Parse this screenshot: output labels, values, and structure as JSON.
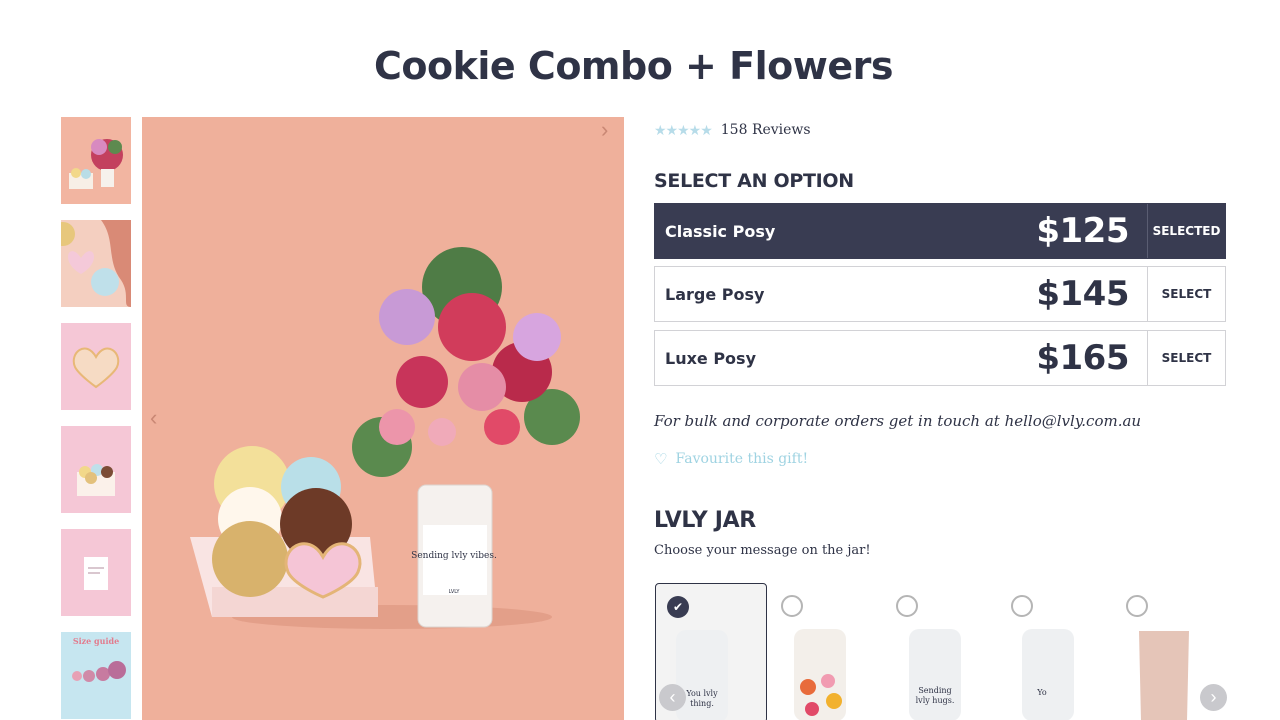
{
  "product": {
    "title": "Cookie Combo + Flowers",
    "stars": "★★★★★",
    "reviews": "158 Reviews"
  },
  "gallery": {
    "prev_icon": "‹",
    "next_icon": "›",
    "main_jar_text": "Sending lvly vibes.",
    "main_jar_brand": "LVLY",
    "size_guide_title": "Size guide"
  },
  "options": {
    "heading": "SELECT AN OPTION",
    "items": [
      {
        "name": "Classic Posy",
        "price": "$125",
        "action": "SELECTED"
      },
      {
        "name": "Large Posy",
        "price": "$145",
        "action": "SELECT"
      },
      {
        "name": "Luxe Posy",
        "price": "$165",
        "action": "SELECT"
      }
    ]
  },
  "bulk_note": "For bulk and corporate orders get in touch at hello@lvly.com.au",
  "favourite": {
    "icon": "heart-outline-icon",
    "label": "Favourite this gift!"
  },
  "jar": {
    "heading": "LVLY JAR",
    "subheading": "Choose your message on the jar!",
    "check": "✔",
    "prev_icon": "‹",
    "next_icon": "›",
    "cards": [
      {
        "text1": "You lvly",
        "text2": "thing."
      },
      {
        "text1": "",
        "text2": ""
      },
      {
        "text1": "Sending",
        "text2": "lvly hugs."
      },
      {
        "text1": "Yo",
        "text2": ""
      },
      {
        "text1": "",
        "text2": ""
      }
    ]
  },
  "colors": {
    "accent": "#393c52",
    "star": "#b7dce9",
    "link": "#9fd3e2",
    "image_bg": "#efb09b"
  }
}
